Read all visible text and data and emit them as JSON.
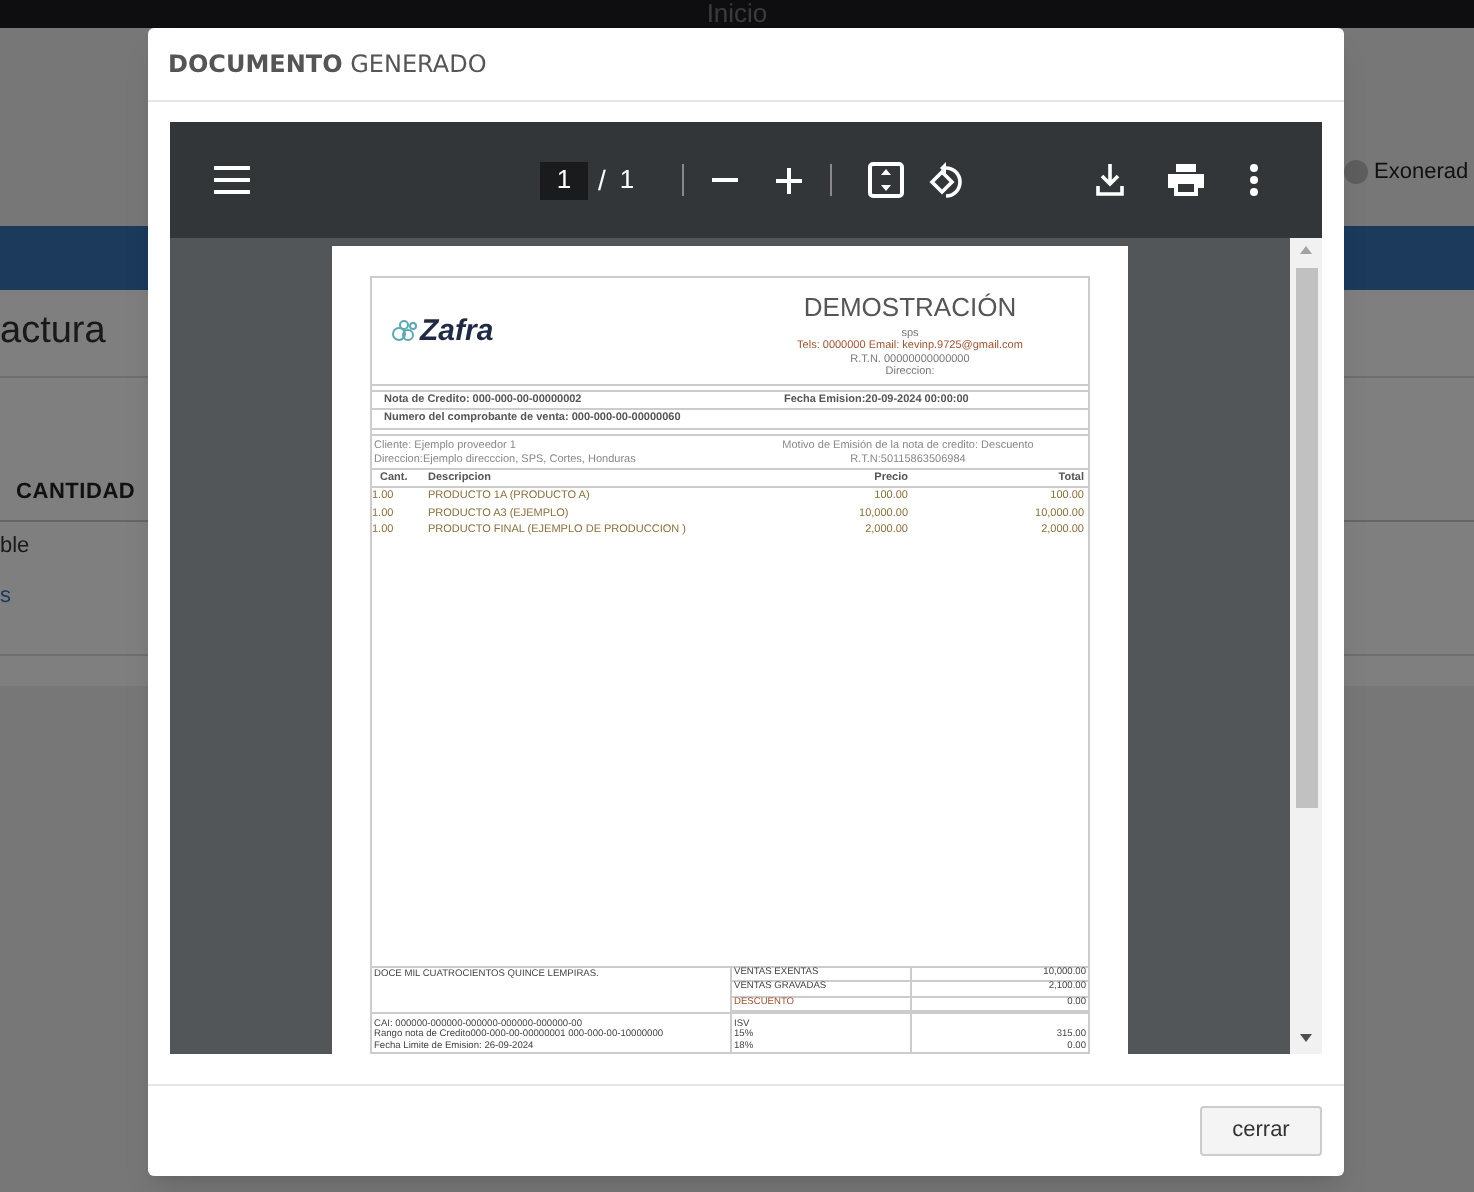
{
  "background": {
    "app_title": "Inicio",
    "toggle": {
      "label": "Exonerad",
      "on": false
    },
    "page_heading": "actura",
    "table": {
      "column": "CANTIDAD",
      "rows": [
        {
          "text": "ble",
          "kind": "text"
        },
        {
          "text": "s",
          "kind": "link"
        }
      ]
    }
  },
  "dialog": {
    "title": "**DOCUMENTO** GENERADO",
    "close_button": "cerrar"
  },
  "pdf_viewer": {
    "page_input": "1",
    "page_separator": "/",
    "page_count": "1"
  },
  "document": {
    "brand": "Zafra",
    "heading": "DEMOSTRACIÓN",
    "company_lines": [
      "sps",
      "Tels: 0000000 Email: kevinp.9725@gmail.com",
      "R.T.N. 00000000000000",
      "Direccion:"
    ],
    "credit_note": "Nota de Credito: 000-000-00-00000002",
    "issue_date": "Fecha Emision:20-09-2024 00:00:00",
    "sale_receipt": "Numero del comprobante de venta: 000-000-00-00000060",
    "client": "Cliente: Ejemplo proveedor 1",
    "reason": "Motivo de Emisión de la nota de credito: Descuento",
    "address": "Direccion:Ejemplo direcccion, SPS, Cortes, Honduras",
    "rtn": "R.T.N:50115863506984",
    "columns": [
      "Cant.",
      "Descripcion",
      "Precio",
      "Total"
    ],
    "rows": [
      [
        "1.00",
        "PRODUCTO 1A (PRODUCTO A)",
        "100.00",
        "100.00"
      ],
      [
        "1.00",
        "PRODUCTO A3 (EJEMPLO)",
        "10,000.00",
        "10,000.00"
      ],
      [
        "1.00",
        "PRODUCTO FINAL (EJEMPLO DE PRODUCCION )",
        "2,000.00",
        "2,000.00"
      ]
    ],
    "amount_in_words": "DOCE MIL CUATROCIENTOS QUINCE LEMPIRAS.",
    "totals": [
      {
        "label": "VENTAS EXENTAS",
        "value": "10,000.00"
      },
      {
        "label": "VENTAS GRAVADAS",
        "value": "2,100.00"
      },
      {
        "label": "DESCUENTO",
        "value": "0.00"
      }
    ],
    "fiscal_lines": [
      "CAI: 000000-000000-000000-000000-000000-00",
      "Rango nota de Credito000-000-00-00000001 000-000-00-10000000",
      "Fecha Limite de Emision: 26-09-2024"
    ],
    "taxes": [
      {
        "label": "ISV"
      },
      {
        "label": "15%",
        "value": "315.00"
      },
      {
        "label": "18%",
        "value": "0.00"
      }
    ]
  }
}
